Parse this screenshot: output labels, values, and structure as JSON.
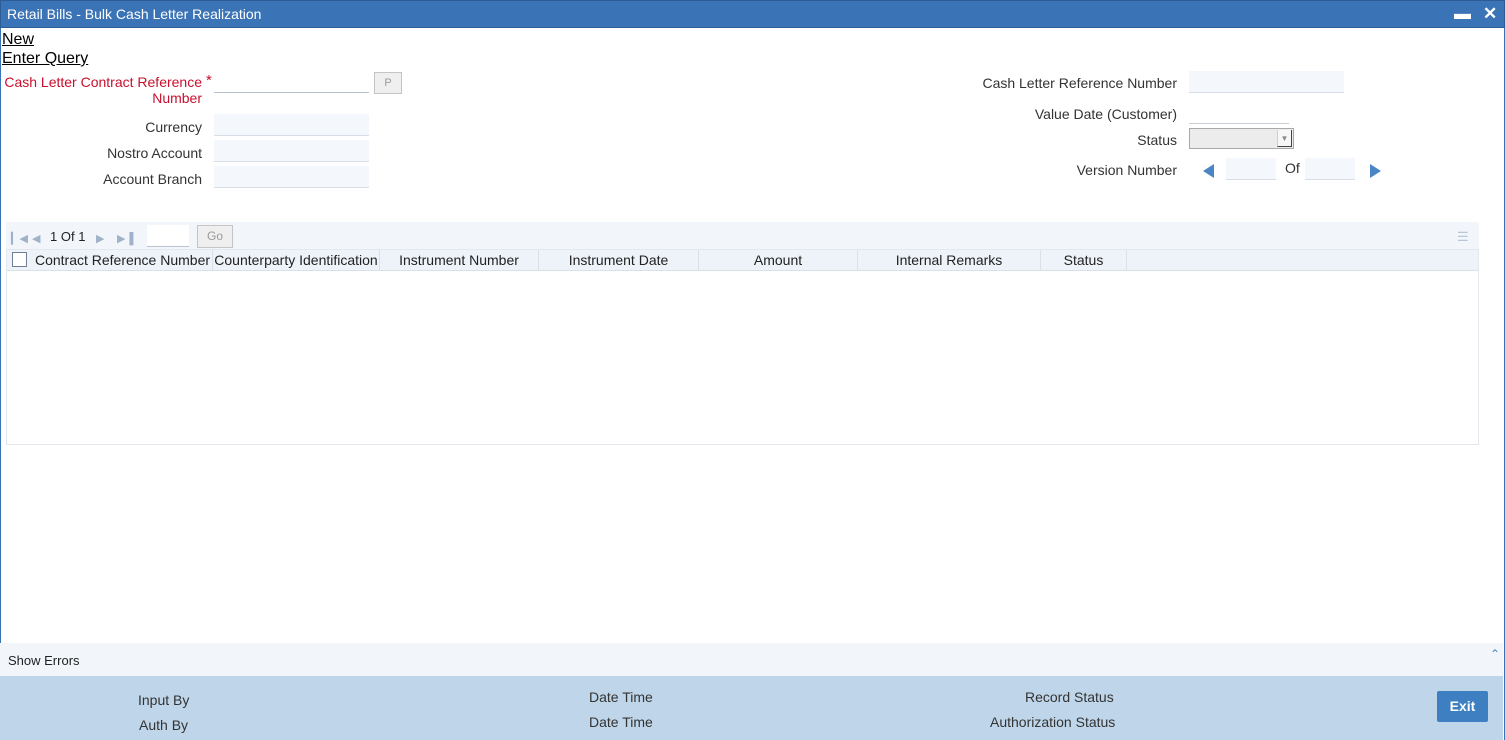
{
  "window": {
    "title": "Retail Bills - Bulk Cash Letter Realization",
    "minimize_icon": "minimize-icon",
    "close_icon": "close-icon"
  },
  "menu": {
    "new": "New",
    "enter_query": "Enter Query"
  },
  "form": {
    "contract_ref_label_line1": "Cash Letter Contract Reference",
    "contract_ref_label_line2": "Number",
    "required_mark": "*",
    "pick_button": "P",
    "currency_label": "Currency",
    "nostro_label": "Nostro Account",
    "branch_label": "Account Branch",
    "cash_letter_ref_label": "Cash Letter Reference Number",
    "value_date_label": "Value Date (Customer)",
    "status_label": "Status",
    "version_label": "Version Number",
    "version_of": "Of"
  },
  "grid": {
    "page_current": "1",
    "page_of": "Of",
    "page_total": "1",
    "go_button": "Go",
    "columns": [
      "Contract Reference Number",
      "Counterparty Identification",
      "Instrument Number",
      "Instrument Date",
      "Amount",
      "Internal Remarks",
      "Status"
    ]
  },
  "errors": {
    "show_errors": "Show Errors"
  },
  "footer": {
    "input_by": "Input By",
    "auth_by": "Auth By",
    "date_time_1": "Date Time",
    "date_time_2": "Date Time",
    "record_status": "Record Status",
    "authorization_status": "Authorization Status",
    "exit": "Exit"
  },
  "colors": {
    "title_bar": "#3a73b6",
    "footer": "#bfd6ea",
    "required": "#c8102e",
    "exit_button": "#3d7fc1"
  }
}
